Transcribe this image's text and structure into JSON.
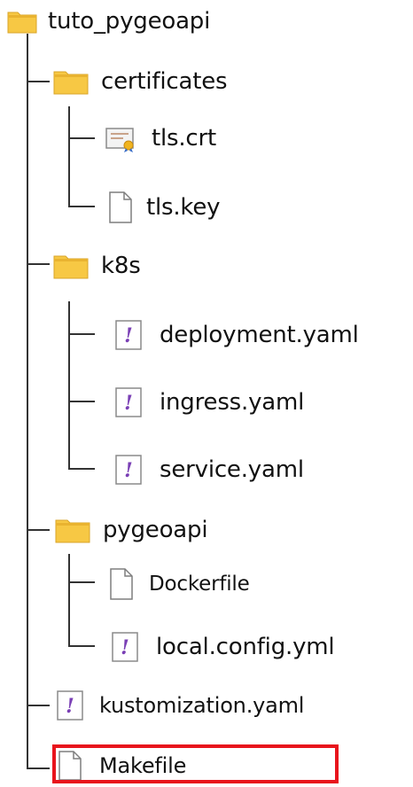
{
  "tree": {
    "root": {
      "label": "tuto_pygeoapi",
      "icon": "folder-icon"
    },
    "certificates": {
      "label": "certificates",
      "icon": "folder-icon",
      "children": [
        {
          "label": "tls.crt",
          "icon": "certificate-file-icon"
        },
        {
          "label": "tls.key",
          "icon": "file-icon"
        }
      ]
    },
    "k8s": {
      "label": "k8s",
      "icon": "folder-icon",
      "children": [
        {
          "label": "deployment.yaml",
          "icon": "yaml-file-icon"
        },
        {
          "label": "ingress.yaml",
          "icon": "yaml-file-icon"
        },
        {
          "label": "service.yaml",
          "icon": "yaml-file-icon"
        }
      ]
    },
    "pygeoapi": {
      "label": "pygeoapi",
      "icon": "folder-icon",
      "children": [
        {
          "label": "Dockerfile",
          "icon": "file-icon"
        },
        {
          "label": "local.config.yml",
          "icon": "yaml-file-icon"
        }
      ]
    },
    "files": [
      {
        "label": "kustomization.yaml",
        "icon": "yaml-file-icon"
      },
      {
        "label": "Makefile",
        "icon": "file-icon",
        "highlighted": true
      }
    ]
  },
  "colors": {
    "folder": "#f7c844",
    "folder_tab": "#e9b330",
    "line": "#333333",
    "highlight": "#e8141c",
    "yaml_mark": "#7a3fb5"
  }
}
